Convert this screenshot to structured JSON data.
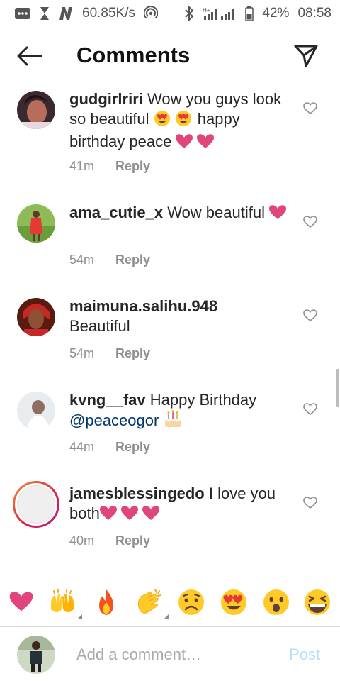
{
  "status_bar": {
    "net_speed": "60.85K/s",
    "battery": "42%",
    "time": "08:58"
  },
  "header": {
    "title": "Comments",
    "back_icon": "arrow-left-icon",
    "share_icon": "paper-plane-icon"
  },
  "comments": [
    {
      "username": "gudgirlriri",
      "text_before": " Wow you guys look so beautiful ",
      "emoji_1": "heart-eyes-emoji heart-eyes-emoji",
      "text_after": " happy birthday peace ",
      "emoji_2": "pink-heart-emoji pink-heart-emoji",
      "time": "41m",
      "reply": "Reply"
    },
    {
      "username": "ama_cutie_x",
      "text_before": " Wow beautiful ",
      "emoji_2": "pink-heart-emoji",
      "time": "54m",
      "reply": "Reply"
    },
    {
      "username": "maimuna.salihu.948",
      "text_before": " Beautiful",
      "time": "54m",
      "reply": "Reply"
    },
    {
      "username": "kvng__fav",
      "text_before": " Happy Birthday ",
      "mention": "@peaceogor",
      "emoji_2": "birthday-cake-emoji",
      "time": "44m",
      "reply": "Reply"
    },
    {
      "username": "jamesblessingedo",
      "text_before": " I love you both",
      "emoji_2": "pink-heart-emoji pink-heart-emoji pink-heart-emoji",
      "time": "40m",
      "reply": "Reply"
    }
  ],
  "emoji_bar": [
    "pink-heart",
    "raising-hands",
    "fire",
    "clapping-hands",
    "frowning-face",
    "heart-eyes",
    "surprised-face",
    "grinning-squint-face"
  ],
  "compose": {
    "placeholder": "Add a comment…",
    "post_label": "Post"
  },
  "colors": {
    "heart": "#e0457b",
    "mention": "#00376b",
    "post_disabled": "#b2dffc",
    "meta": "#8e8e8e"
  }
}
